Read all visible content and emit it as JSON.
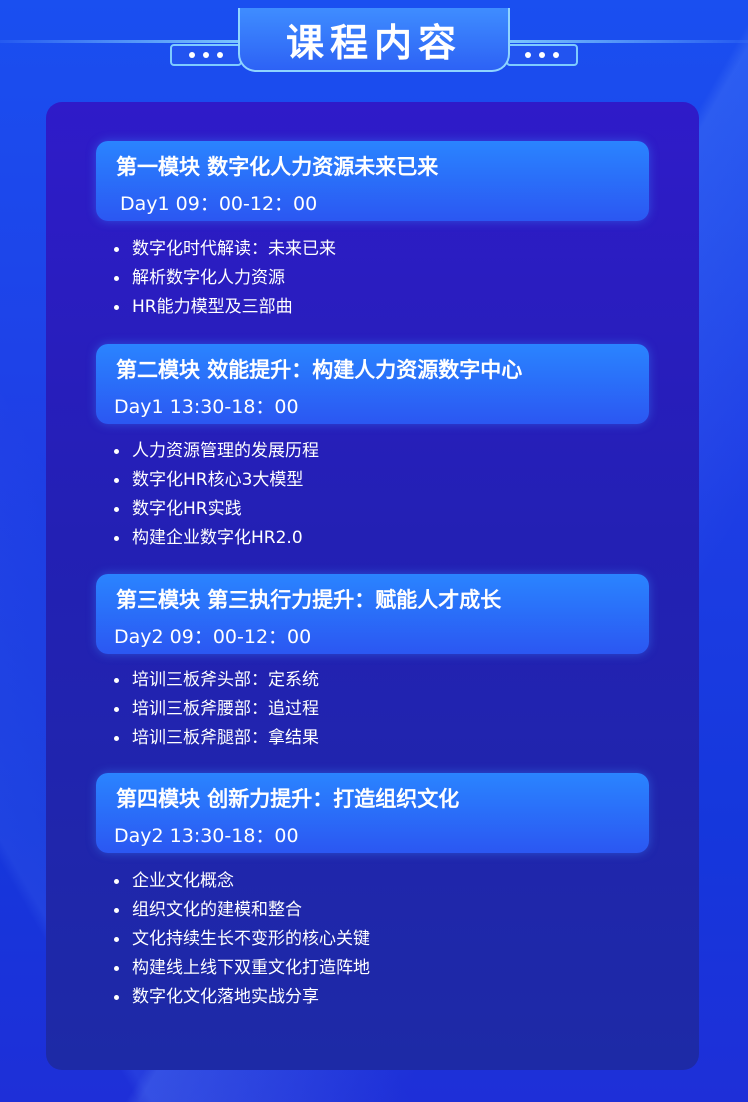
{
  "header": {
    "title": "课程内容",
    "colors": {
      "accent": "#7ecbff",
      "tab": "#3f8dff",
      "panel": "#2f1bc9"
    }
  },
  "modules": [
    {
      "title": "第一模块   数字化人力资源未来已来",
      "time": "Day1  09：00-12：00",
      "items": [
        "数字化时代解读：未来已来",
        "解析数字化人力资源",
        "HR能力模型及三部曲"
      ]
    },
    {
      "title": "第二模块   效能提升：构建人力资源数字中心",
      "time": "Day1  13:30-18：00",
      "items": [
        "人力资源管理的发展历程",
        "数字化HR核心3大模型",
        "数字化HR实践",
        "构建企业数字化HR2.0"
      ]
    },
    {
      "title": "第三模块   第三执行力提升：赋能人才成长",
      "time": "Day2   09：00-12：00",
      "items": [
        "培训三板斧头部：定系统",
        "培训三板斧腰部：追过程",
        "培训三板斧腿部：拿结果"
      ]
    },
    {
      "title": "第四模块   创新力提升：打造组织文化",
      "time": "Day2  13:30-18：00",
      "items": [
        "企业文化概念",
        "组织文化的建模和整合",
        "文化持续生长不变形的核心关键",
        "构建线上线下双重文化打造阵地",
        "数字化文化落地实战分享"
      ]
    }
  ]
}
